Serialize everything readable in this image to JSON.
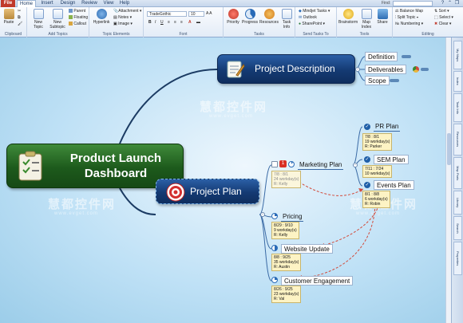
{
  "tabs": [
    "File",
    "Home",
    "Insert",
    "Design",
    "Review",
    "View",
    "Help"
  ],
  "find_label": "Find:",
  "ribbon": {
    "clipboard": {
      "label": "Clipboard",
      "paste": "Paste"
    },
    "add_topics": {
      "label": "Add Topics",
      "new_topic": "New Topic",
      "new_subtopic": "New Subtopic",
      "parent": "Parent",
      "floating": "Floating",
      "callout": "Callout"
    },
    "topic_elements": {
      "label": "Topic Elements",
      "hyperlink": "Hyperlink",
      "attachment": "Attachment",
      "notes": "Notes",
      "image": "Image"
    },
    "font": {
      "label": "Font",
      "family": "TradeGothic",
      "size": "10"
    },
    "tasks": {
      "label": "Tasks",
      "priority": "Priority",
      "progress": "Progress",
      "resources": "Resources",
      "task_info": "Task Info"
    },
    "send_tasks": {
      "label": "Send Tasks To",
      "mindjet_tasks": "Mindjet Tasks",
      "outlook": "Outlook",
      "sharepoint": "SharePoint"
    },
    "tools": {
      "label": "Tools",
      "brainstorm": "Brainstorm",
      "map_index": "Map Index",
      "share": "Share"
    },
    "editing": {
      "label": "Editing",
      "balance_map": "Balance Map",
      "split_topic": "Split Topic",
      "numbering": "Numbering",
      "sort": "Sort",
      "select": "Select",
      "clear": "Clear"
    }
  },
  "right_panel": [
    "My Maps",
    "Index",
    "Task Info",
    "Resources",
    "Map Parts",
    "Library",
    "Search",
    "Properties"
  ],
  "map": {
    "central": "Product Launch\nDashboard",
    "description": {
      "label": "Project Description",
      "children": [
        "Definition",
        "Deliverables",
        "Scope"
      ]
    },
    "plan": {
      "label": "Project Plan",
      "marketing": {
        "label": "Marketing Plan",
        "priority": "1",
        "info": [
          "7/8 : 8/1",
          "24 workday(s)",
          "R: Kelly"
        ],
        "children": [
          {
            "label": "PR Plan",
            "info": [
              "7/8 : 8/1",
              "19 workday(s)",
              "R: Parker"
            ]
          },
          {
            "label": "SEM Plan",
            "info": [
              "7/11 : 7/24",
              "10 workday(s)"
            ]
          },
          {
            "label": "Events Plan",
            "info": [
              "8/1 : 8/8",
              "6 workday(s)",
              "R: Robin"
            ]
          }
        ]
      },
      "tasks": [
        {
          "label": "Pricing",
          "info": [
            "8/29 : 9/10",
            "9 workday(s)",
            "R: Kelly"
          ]
        },
        {
          "label": "Website Update",
          "info": [
            "8/8 : 9/25",
            "35 workday(s)",
            "R: Austin"
          ]
        },
        {
          "label": "Customer Engagement",
          "info": [
            "8/26 : 9/25",
            "23 workday(s)",
            "R: Val"
          ]
        }
      ]
    }
  },
  "watermark": {
    "cn": "慧都控件网",
    "url": "www.evget.com"
  }
}
